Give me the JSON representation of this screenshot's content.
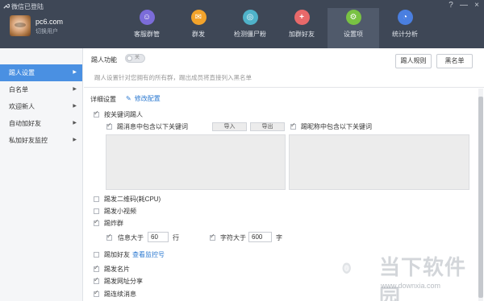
{
  "window": {
    "title": "微信已登陆",
    "controls": [
      "?",
      "—",
      "×"
    ]
  },
  "user": {
    "name": "pc6.com",
    "subtitle": "切换用户"
  },
  "nav": [
    {
      "label": "客服群管",
      "icon": "person-icon",
      "color": "#7b6cd9",
      "glyph": "☺"
    },
    {
      "label": "群发",
      "icon": "megaphone-icon",
      "color": "#f2a32b",
      "glyph": "✉"
    },
    {
      "label": "检测僵尸粉",
      "icon": "magnifier-icon",
      "color": "#4fb2c9",
      "glyph": "◎"
    },
    {
      "label": "加群好友",
      "icon": "add-friend-icon",
      "color": "#e8696a",
      "glyph": "+"
    },
    {
      "label": "设置项",
      "icon": "gear-icon",
      "color": "#79c243",
      "glyph": "⚙"
    },
    {
      "label": "统计分析",
      "icon": "pie-chart-icon",
      "color": "#4a7fe0",
      "glyph": "◔"
    }
  ],
  "sidebar": {
    "items": [
      {
        "label": "踢人设置",
        "active": true
      },
      {
        "label": "白名单",
        "active": false
      },
      {
        "label": "欢迎新人",
        "active": false
      },
      {
        "label": "自动加好友",
        "active": false
      },
      {
        "label": "私加好友监控",
        "active": false
      }
    ]
  },
  "main": {
    "title": "踢人功能",
    "toggle_text": "关",
    "btn_rules": "踢人规则",
    "btn_blacklist": "黑名单",
    "description": "踢人设置针对您拥有的所有群，踢出成员将直接列入黑名单",
    "detail_title": "详细设置",
    "edit_label": "修改配置",
    "kick_keyword": "按关键词踢人",
    "msg_keyword": "踢消息中包含以下关键词",
    "import": "导入",
    "export": "导出",
    "nick_keyword": "踢昵称中包含以下关键词",
    "qr": "踢发二维码(耗CPU)",
    "video": "踢发小视频",
    "flood": "踢炸群",
    "msg_over": "信息大于",
    "msg_over_value": "60",
    "msg_unit": "行",
    "char_over": "字符大于",
    "char_over_value": "600",
    "char_unit": "字",
    "add_friend": "踢加好友",
    "view_monitor": "查看监控号",
    "card": "踢发名片",
    "share_link": "踢发网址分享",
    "continuous": "踢连续消息"
  },
  "watermark": {
    "line1": "当下软件园",
    "line2": "www.downxia.com"
  }
}
